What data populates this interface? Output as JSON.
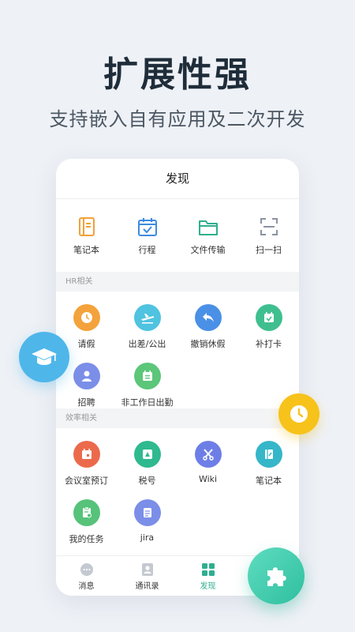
{
  "hero": {
    "title": "扩展性强",
    "subtitle": "支持嵌入自有应用及二次开发"
  },
  "phone": {
    "header_title": "发现",
    "quick_actions": [
      {
        "label": "笔记本",
        "icon": "notebook-icon",
        "color": "#f0a23a"
      },
      {
        "label": "行程",
        "icon": "calendar-check-icon",
        "color": "#3e8be0"
      },
      {
        "label": "文件传输",
        "icon": "folder-icon",
        "color": "#2fae8f"
      },
      {
        "label": "扫一扫",
        "icon": "scan-icon",
        "color": "#8a93a3"
      }
    ],
    "sections": [
      {
        "title": "HR相关",
        "items": [
          {
            "label": "请假",
            "icon": "clock-icon",
            "color": "#f4a23b"
          },
          {
            "label": "出差/公出",
            "icon": "airplane-icon",
            "color": "#4fc3e0"
          },
          {
            "label": "撤销休假",
            "icon": "undo-arrow-icon",
            "color": "#4a90e6"
          },
          {
            "label": "补打卡",
            "icon": "calendar-check-icon",
            "color": "#3fbf8f"
          },
          {
            "label": "招聘",
            "icon": "person-icon",
            "color": "#7b8ee8"
          },
          {
            "label": "非工作日出勤",
            "icon": "calendar-shift-icon",
            "color": "#5cc679"
          }
        ]
      },
      {
        "title": "效率相关",
        "items": [
          {
            "label": "会议室预订",
            "icon": "calendar-icon",
            "color": "#ec6a4c"
          },
          {
            "label": "税号",
            "icon": "id-card-icon",
            "color": "#2fb98f"
          },
          {
            "label": "Wiki",
            "icon": "scissors-icon",
            "color": "#6d7fe6"
          },
          {
            "label": "笔记本",
            "icon": "notebook-edit-icon",
            "color": "#35b6c9"
          },
          {
            "label": "我的任务",
            "icon": "task-clipboard-icon",
            "color": "#56c27a"
          },
          {
            "label": "jira",
            "icon": "document-icon",
            "color": "#7b8ee8"
          }
        ]
      }
    ],
    "tabbar": [
      {
        "label": "消息",
        "icon": "chat-bubble-icon"
      },
      {
        "label": "通讯录",
        "icon": "contacts-icon"
      },
      {
        "label": "发现",
        "icon": "grid-apps-icon",
        "active": true
      }
    ]
  },
  "floating_icons": [
    "graduation-cap-icon",
    "clock-icon",
    "puzzle-icon"
  ]
}
